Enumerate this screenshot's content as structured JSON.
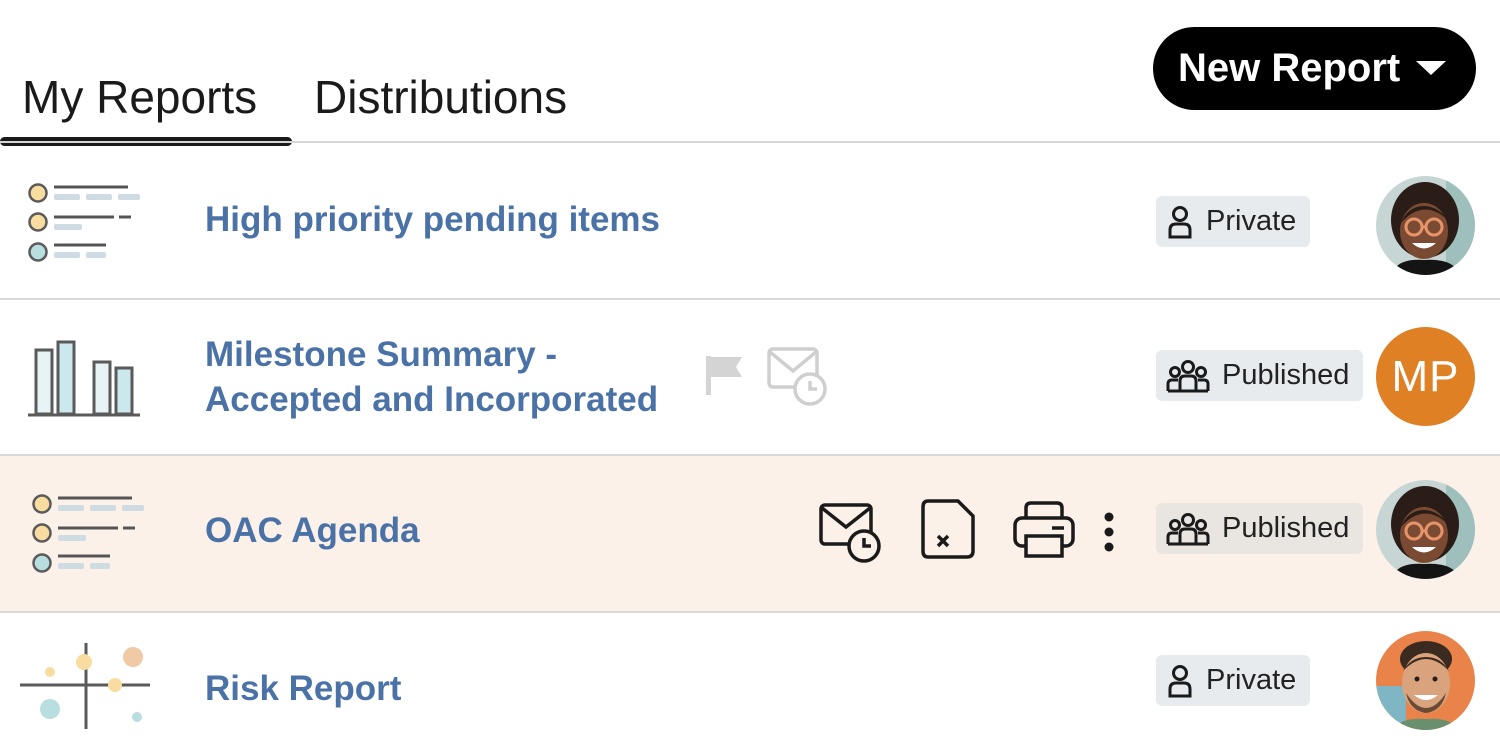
{
  "tabs": [
    {
      "label": "My Reports",
      "active": true
    },
    {
      "label": "Distributions",
      "active": false
    }
  ],
  "new_report": {
    "label": "New Report"
  },
  "reports": [
    {
      "title": "High priority pending items",
      "icon": "list-report-icon",
      "visibility": "Private",
      "visibility_icon": "person-icon",
      "owner": {
        "avatar": "woman-glasses-avatar"
      }
    },
    {
      "title_line1": "Milestone Summary -",
      "title_line2": "Accepted and Incorporated",
      "icon": "bar-chart-report-icon",
      "status_icons": [
        "flag-icon",
        "scheduled-email-icon"
      ],
      "visibility": "Published",
      "visibility_icon": "group-icon",
      "owner": {
        "initials": "MP",
        "color": "#e08024"
      }
    },
    {
      "title": "OAC Agenda",
      "icon": "list-report-icon",
      "actions": [
        "scheduled-email-icon",
        "export-excel-icon",
        "print-icon",
        "more-options-icon"
      ],
      "visibility": "Published",
      "visibility_icon": "group-icon",
      "owner": {
        "avatar": "woman-glasses-avatar"
      },
      "highlighted": true
    },
    {
      "title": "Risk Report",
      "icon": "scatter-report-icon",
      "visibility": "Private",
      "visibility_icon": "person-icon",
      "owner": {
        "avatar": "man-smiling-avatar"
      }
    }
  ],
  "colors": {
    "accent": "#4a72a6",
    "row_highlight": "#fbf1e8",
    "badge_bg": "#e8ebee",
    "mp_avatar": "#e08024"
  }
}
